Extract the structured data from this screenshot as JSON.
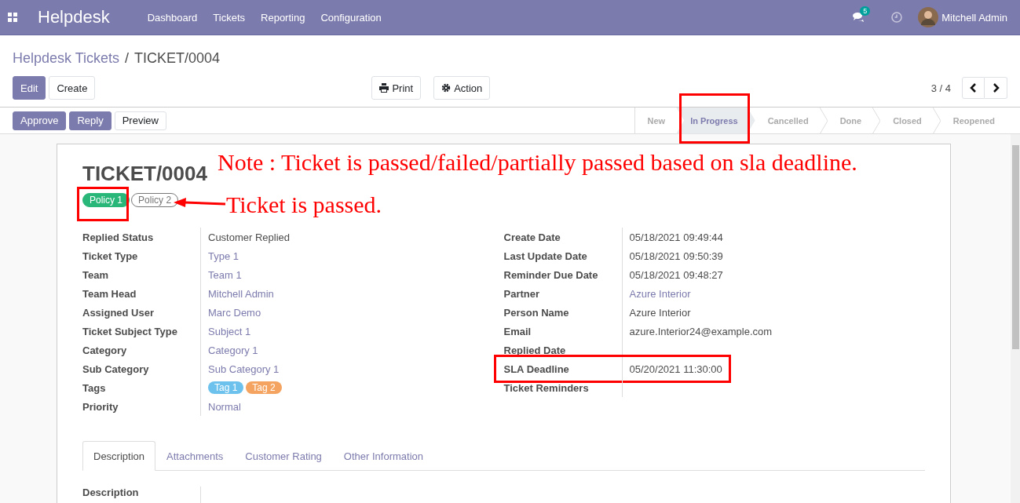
{
  "navbar": {
    "app_name": "Helpdesk",
    "menu": [
      "Dashboard",
      "Tickets",
      "Reporting",
      "Configuration"
    ],
    "message_count": "5",
    "user": "Mitchell Admin"
  },
  "breadcrumb": {
    "parent": "Helpdesk Tickets",
    "separator": "/",
    "current": "TICKET/0004"
  },
  "buttons": [
    {
      "label": "Edit",
      "kind": "primary"
    },
    {
      "label": "Create",
      "kind": "secondary"
    }
  ],
  "actions": [
    {
      "label": "Print",
      "kind": "print"
    },
    {
      "label": "Action",
      "kind": "gear"
    }
  ],
  "pager": {
    "text": "3 / 4"
  },
  "header_buttons": [
    {
      "label": "Approve",
      "kind": "primary"
    },
    {
      "label": "Reply",
      "kind": "primary"
    },
    {
      "label": "Preview",
      "kind": "secondary"
    }
  ],
  "stages": [
    {
      "label": "New",
      "selected": false
    },
    {
      "label": "In Progress",
      "selected": true,
      "highlighted": true
    },
    {
      "label": "Cancelled",
      "selected": false
    },
    {
      "label": "Done",
      "selected": false
    },
    {
      "label": "Closed",
      "selected": false
    },
    {
      "label": "Reopened",
      "selected": false
    }
  ],
  "ticket": {
    "title": "TICKET/0004",
    "policies": [
      {
        "label": "Policy 1",
        "passed": true,
        "highlighted": true
      },
      {
        "label": "Policy 2",
        "passed": false
      }
    ],
    "left_fields": [
      {
        "label": "Replied Status",
        "value": "Customer Replied",
        "kind": "text"
      },
      {
        "label": "Ticket Type",
        "value": "Type 1",
        "kind": "link"
      },
      {
        "label": "Team",
        "value": "Team 1",
        "kind": "link"
      },
      {
        "label": "Team Head",
        "value": "Mitchell Admin",
        "kind": "link"
      },
      {
        "label": "Assigned User",
        "value": "Marc Demo",
        "kind": "link"
      },
      {
        "label": "Ticket Subject Type",
        "value": "Subject 1",
        "kind": "link"
      },
      {
        "label": "Category",
        "value": "Category 1",
        "kind": "link"
      },
      {
        "label": "Sub Category",
        "value": "Sub Category 1",
        "kind": "link"
      },
      {
        "label": "Tags",
        "kind": "tags",
        "tags": [
          {
            "label": "Tag 1",
            "color": "#6cc1ed"
          },
          {
            "label": "Tag 2",
            "color": "#f4a460"
          }
        ]
      },
      {
        "label": "Priority",
        "value": "Normal",
        "kind": "link"
      }
    ],
    "right_fields": [
      {
        "label": "Create Date",
        "value": "05/18/2021 09:49:44",
        "kind": "text"
      },
      {
        "label": "Last Update Date",
        "value": "05/18/2021 09:50:39",
        "kind": "text"
      },
      {
        "label": "Reminder Due Date",
        "value": "05/18/2021 09:48:27",
        "kind": "text"
      },
      {
        "label": "Partner",
        "value": "Azure Interior",
        "kind": "link"
      },
      {
        "label": "Person Name",
        "value": "Azure Interior",
        "kind": "text"
      },
      {
        "label": "Email",
        "value": "azure.Interior24@example.com",
        "kind": "text"
      },
      {
        "label": "Replied Date",
        "kind": "empty"
      },
      {
        "label": "SLA Deadline",
        "value": "05/20/2021 11:30:00",
        "kind": "text",
        "highlighted": true
      },
      {
        "label": "Ticket Reminders",
        "kind": "empty"
      }
    ],
    "tabs": [
      {
        "label": "Description",
        "selected": true
      },
      {
        "label": "Attachments",
        "selected": false
      },
      {
        "label": "Customer Rating",
        "selected": false
      },
      {
        "label": "Other Information",
        "selected": false
      }
    ],
    "description_label": "Description"
  },
  "annotations": {
    "note": "Note : Ticket is passed/failed/partially passed based on sla deadline.",
    "arrow_label": "Ticket is passed."
  }
}
